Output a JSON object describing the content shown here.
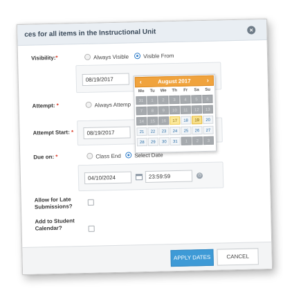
{
  "dialog": {
    "title": "ces for all items in the Instructional Unit",
    "close_glyph": "×"
  },
  "visibility": {
    "label": "Visibility:",
    "required_mark": "*",
    "option_always": "Always Visible",
    "option_from": "Visible From",
    "selected": "Visible From",
    "date": "08/19/2017"
  },
  "attempt": {
    "label": "Attempt:",
    "required_mark": "*",
    "option_always": "Always Attemp"
  },
  "attempt_start": {
    "label": "Attempt Start:",
    "required_mark": "*",
    "date": "08/19/2017"
  },
  "due_on": {
    "label": "Due on:",
    "required_mark": "*",
    "option_class_end": "Class End",
    "option_select_date": "Select Date",
    "selected": "Select Date",
    "date": "04/10/2024",
    "time": "23:59:59"
  },
  "late_submissions": {
    "label": "Allow for Late Submissions?",
    "checked": false
  },
  "student_calendar": {
    "label": "Add to Student Calendar?",
    "checked": false
  },
  "footer": {
    "apply_label": "APPLY DATES",
    "cancel_label": "CANCEL"
  },
  "datepicker": {
    "month_label": "August 2017",
    "prev_glyph": "‹",
    "next_glyph": "›",
    "weekdays": [
      "Mo",
      "Tu",
      "We",
      "Th",
      "Fr",
      "Sa",
      "Su"
    ],
    "rows": [
      [
        {
          "d": "31",
          "s": "out"
        },
        {
          "d": "1",
          "s": "out"
        },
        {
          "d": "2",
          "s": "out"
        },
        {
          "d": "3",
          "s": "out"
        },
        {
          "d": "4",
          "s": "out"
        },
        {
          "d": "5",
          "s": "out"
        },
        {
          "d": "6",
          "s": "out"
        }
      ],
      [
        {
          "d": "7",
          "s": "out"
        },
        {
          "d": "8",
          "s": "out"
        },
        {
          "d": "9",
          "s": "out"
        },
        {
          "d": "10",
          "s": "out"
        },
        {
          "d": "11",
          "s": "out"
        },
        {
          "d": "12",
          "s": "out"
        },
        {
          "d": "13",
          "s": "out"
        }
      ],
      [
        {
          "d": "14",
          "s": "out"
        },
        {
          "d": "15",
          "s": "out"
        },
        {
          "d": "16",
          "s": "out"
        },
        {
          "d": "17",
          "s": "hl"
        },
        {
          "d": "18",
          "s": ""
        },
        {
          "d": "19",
          "s": "sel"
        },
        {
          "d": "20",
          "s": ""
        }
      ],
      [
        {
          "d": "21",
          "s": ""
        },
        {
          "d": "22",
          "s": ""
        },
        {
          "d": "23",
          "s": ""
        },
        {
          "d": "24",
          "s": ""
        },
        {
          "d": "25",
          "s": ""
        },
        {
          "d": "26",
          "s": ""
        },
        {
          "d": "27",
          "s": ""
        }
      ],
      [
        {
          "d": "28",
          "s": ""
        },
        {
          "d": "29",
          "s": ""
        },
        {
          "d": "30",
          "s": ""
        },
        {
          "d": "31",
          "s": ""
        },
        {
          "d": "1",
          "s": "out"
        },
        {
          "d": "2",
          "s": "out"
        },
        {
          "d": "3",
          "s": "out"
        }
      ]
    ]
  },
  "colors": {
    "accent": "#3e9ad6",
    "datepicker_header": "#f0a33d",
    "required": "#d9331f"
  }
}
